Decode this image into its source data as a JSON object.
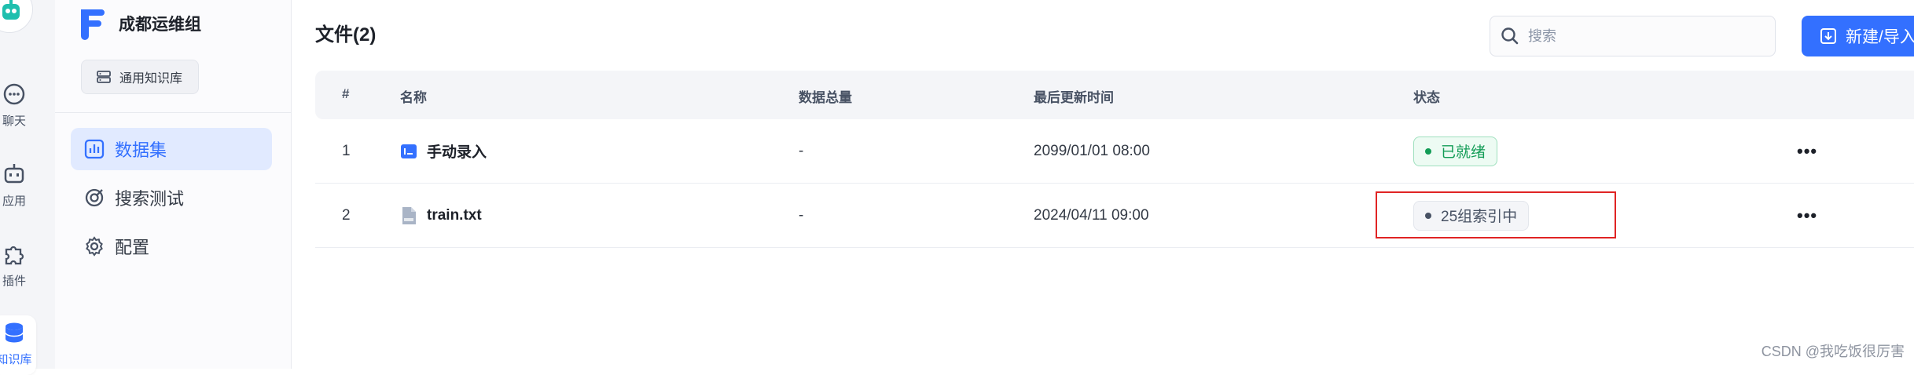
{
  "rail": {
    "items": [
      {
        "label": "聊天",
        "icon": "chat-icon"
      },
      {
        "label": "应用",
        "icon": "robot-icon"
      },
      {
        "label": "插件",
        "icon": "puzzle-icon"
      },
      {
        "label": "知识库",
        "icon": "database-icon"
      }
    ]
  },
  "sidebar": {
    "kb_name": "成都运维组",
    "kb_type": "通用知识库",
    "menu": [
      {
        "label": "数据集",
        "icon": "dataset-icon"
      },
      {
        "label": "搜索测试",
        "icon": "search-test-icon"
      },
      {
        "label": "配置",
        "icon": "gear-icon"
      }
    ]
  },
  "main": {
    "title": "文件(2)",
    "search_placeholder": "搜索",
    "new_button": "新建/导入",
    "columns": [
      "#",
      "名称",
      "数据总量",
      "最后更新时间",
      "状态"
    ],
    "rows": [
      {
        "index": "1",
        "name": "手动录入",
        "icon": "manual-entry-icon",
        "total": "-",
        "updated": "2099/01/01 08:00",
        "status": "已就绪",
        "status_type": "ready"
      },
      {
        "index": "2",
        "name": "train.txt",
        "icon": "txt-file-icon",
        "total": "-",
        "updated": "2024/04/11 09:00",
        "status": "25组索引中",
        "status_type": "indexing"
      }
    ],
    "more_label": "•••"
  },
  "watermark": "CSDN @我吃饭很厉害",
  "colors": {
    "accent": "#3370ff",
    "ready": "#129c56",
    "highlight": "#e02424"
  }
}
